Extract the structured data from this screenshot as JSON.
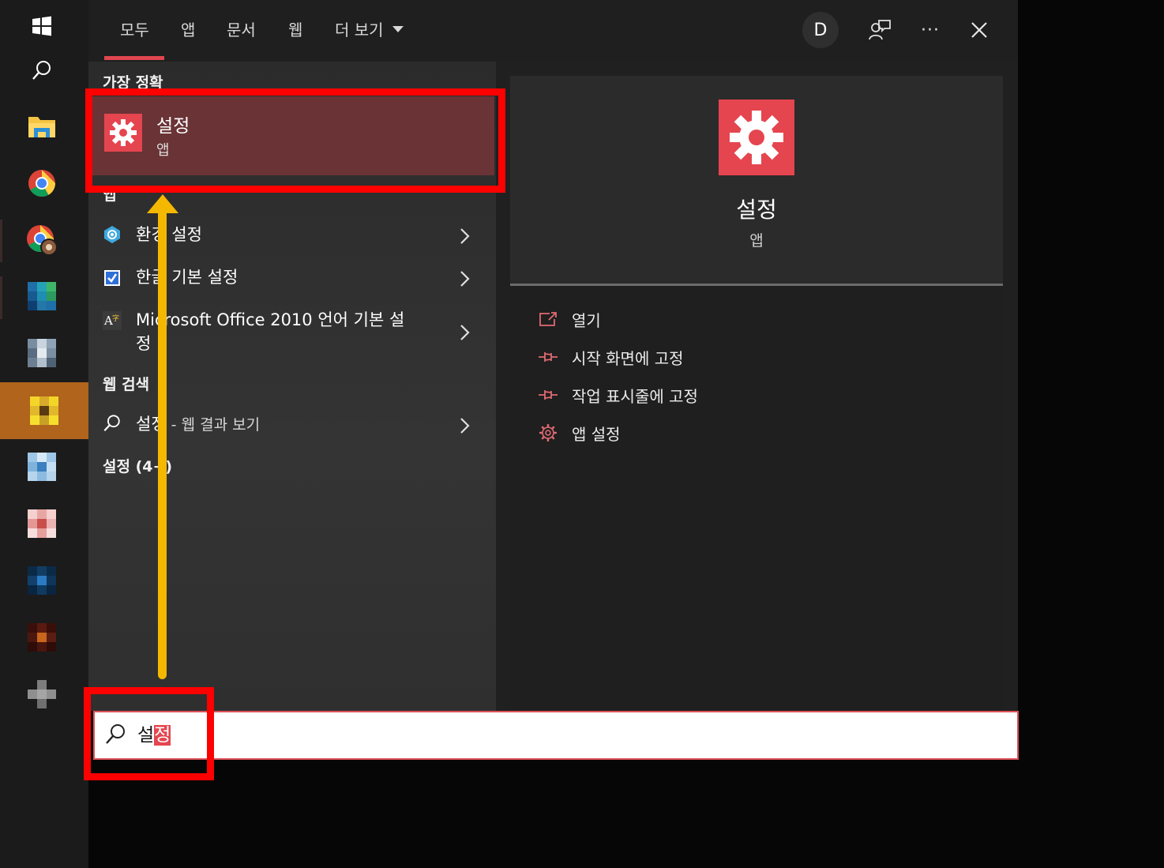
{
  "tabs": [
    "모두",
    "앱",
    "문서",
    "웹",
    "더 보기"
  ],
  "header": {
    "avatar_letter": "D",
    "more_label": "···"
  },
  "sections": {
    "best_match": "가장 정확",
    "apps": "앱",
    "web_search": "웹 검색",
    "settings_group": "설정 (4+)"
  },
  "best_match": {
    "title": "설정",
    "subtitle": "앱"
  },
  "app_results": [
    {
      "label": "환경 설정"
    },
    {
      "label": "한글 기본 설정"
    },
    {
      "label_line1": "Microsoft Office 2010 언어 기본 설",
      "label_line2": "정"
    }
  ],
  "web_result": {
    "query": "설정",
    "suffix": " - 웹 결과 보기"
  },
  "detail": {
    "title": "설정",
    "subtitle": "앱",
    "actions": [
      "열기",
      "시작 화면에 고정",
      "작업 표시줄에 고정",
      "앱 설정"
    ]
  },
  "search": {
    "typed": "설",
    "composing": "정"
  },
  "colors": {
    "accent": "#e5454f",
    "highlight_box": "#ff0000",
    "arrow": "#f5b800",
    "selected_row": "#6a3336"
  },
  "taskbar_icons": [
    "windows-start-icon",
    "search-icon",
    "file-explorer-icon",
    "chrome-icon",
    "chrome-profile-icon",
    "app-icon",
    "app-icon",
    "app-icon",
    "app-icon",
    "app-icon",
    "app-icon",
    "app-icon",
    "app-icon"
  ]
}
